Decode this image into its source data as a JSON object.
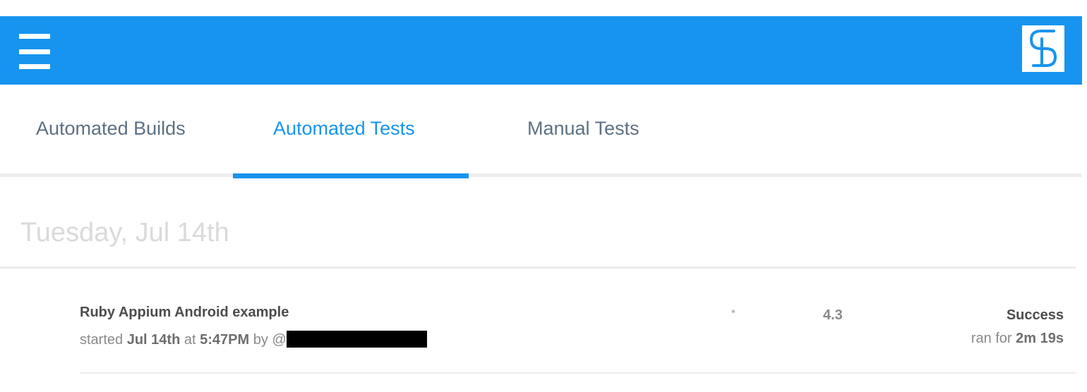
{
  "colors": {
    "brand": "#1794ef",
    "tab_inactive": "#5d7184",
    "text_dark": "#4d4d4d",
    "text_muted": "#8a8a8a",
    "date_header": "#dadada"
  },
  "header": {
    "menu_icon": "hamburger-menu-icon",
    "logo_icon": "s-logo-icon"
  },
  "tabs": [
    {
      "label": "Automated Builds",
      "active": false
    },
    {
      "label": "Automated Tests",
      "active": true
    },
    {
      "label": "Manual Tests",
      "active": false
    }
  ],
  "day_group": {
    "date": "Tuesday, Jul 14th",
    "tests": [
      {
        "title": "Ruby Appium Android example",
        "started_prefix": "started",
        "date": "Jul 14th",
        "at": "at",
        "time": "5:47PM",
        "by": "by @",
        "marker": "*",
        "version": "4.3",
        "status": "Success",
        "duration_prefix": "ran for",
        "duration": "2m 19s"
      }
    ]
  }
}
